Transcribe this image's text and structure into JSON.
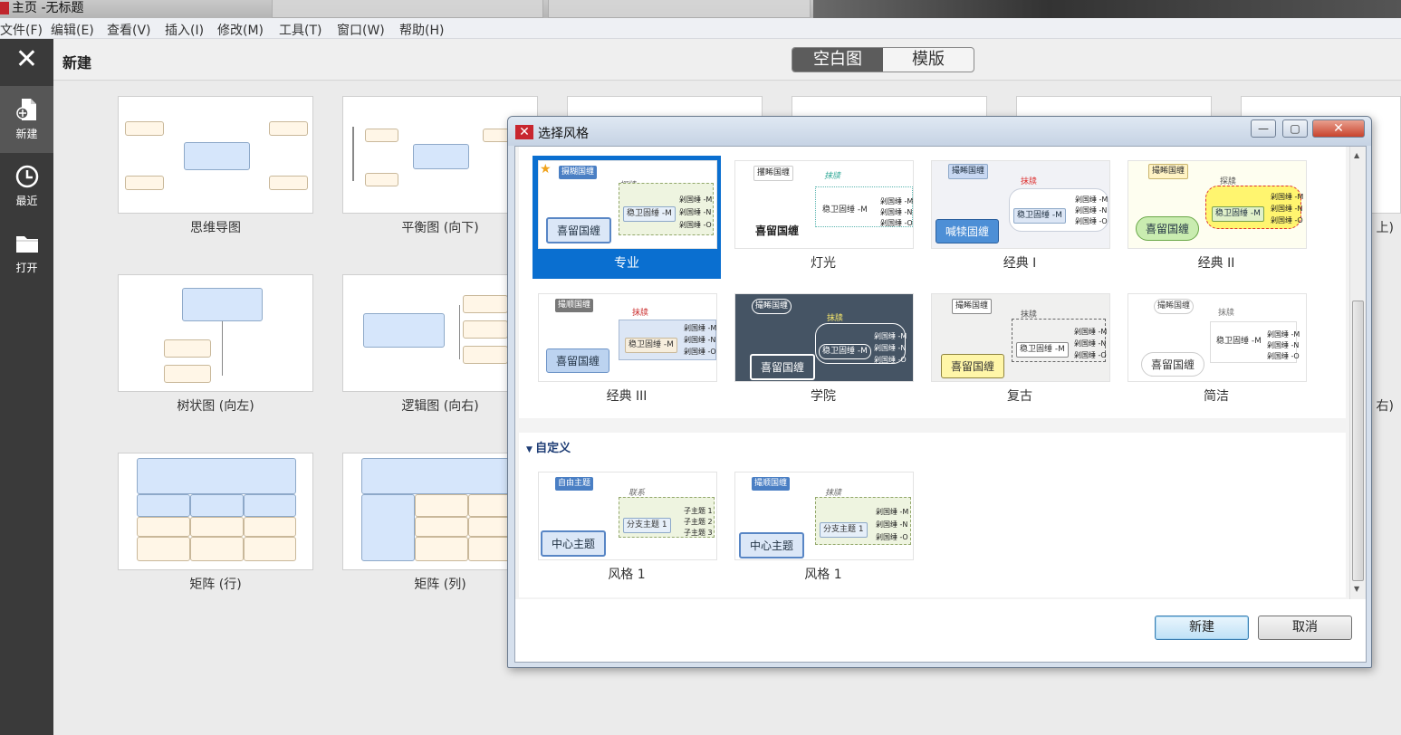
{
  "window": {
    "title": "主页 -无标题"
  },
  "menu": [
    "文件(F)",
    "编辑(E)",
    "查看(V)",
    "插入(I)",
    "修改(M)",
    "工具(T)",
    "窗口(W)",
    "帮助(H)"
  ],
  "sidebar": {
    "items": [
      {
        "label": "新建",
        "icon": "new-file-icon"
      },
      {
        "label": "最近",
        "icon": "clock-icon"
      },
      {
        "label": "打开",
        "icon": "folder-icon"
      }
    ]
  },
  "toolbar": {
    "heading": "新建",
    "segments": [
      "空白图",
      "模版"
    ]
  },
  "gallery": {
    "captions": [
      "思维导图",
      "平衡图 (向下)",
      "树状图 (向左)",
      "逻辑图 (向右)",
      "矩阵 (行)",
      "矩阵 (列)"
    ],
    "right_edge_captions": [
      "上)",
      "右)"
    ]
  },
  "dialog": {
    "title": "选择风格",
    "styles": [
      {
        "label": "专业",
        "main": "喜留国缠",
        "sub": "稳卫固缍 -M",
        "float": "摄糊国缠",
        "tag": "探牍",
        "selected": true
      },
      {
        "label": "灯光",
        "main": "喜留国缠",
        "sub": "稳卫固缍 -M",
        "float": "攫睎国缠",
        "tag": "抹牍"
      },
      {
        "label": "经典 I",
        "main": "喊犊固缠",
        "sub": "稳卫固缍 -M",
        "float": "撮睎国缠",
        "tag": "抹牍"
      },
      {
        "label": "经典 II",
        "main": "喜留国缠",
        "sub": "稳卫固缍 -M",
        "float": "撮睎国缠",
        "tag": "探牍"
      },
      {
        "label": "经典 III",
        "main": "喜留国缠",
        "sub": "稳卫固缍 -M",
        "float": "撮顺国缠",
        "tag": "抹牍"
      },
      {
        "label": "学院",
        "main": "喜留国缠",
        "sub": "稳卫固缍 -M",
        "float": "撮睎国缠",
        "tag": "抹牍"
      },
      {
        "label": "复古",
        "main": "喜留国缠",
        "sub": "稳卫固缍 -M",
        "float": "撮睎国缠",
        "tag": "抹牍"
      },
      {
        "label": "简洁",
        "main": "喜留国缠",
        "sub": "稳卫固缍 -M",
        "float": "撮睎国缠",
        "tag": "抹牍"
      }
    ],
    "branch_items": [
      "剁国缍 -M",
      "剁国缍 -N",
      "剁国缍 -O"
    ],
    "custom_group": "自定义",
    "custom_styles": [
      {
        "label": "风格 1",
        "main": "中心主题",
        "sub": "分支主题 1",
        "float": "自由主题",
        "tag": "联系",
        "branches": [
          "子主题 1",
          "子主题 2",
          "子主题 3"
        ]
      },
      {
        "label": "风格 1",
        "main": "中心主题",
        "sub": "分支主题 1",
        "float": "撮顺国缠",
        "tag": "抹牍",
        "branches": [
          "剁国缍 -M",
          "剁国缍 -N",
          "剁国缍 -O"
        ]
      }
    ],
    "buttons": {
      "ok": "新建",
      "cancel": "取消"
    }
  },
  "colors": {
    "accent": "#0a6fd0",
    "sidebar": "#3a3a3a",
    "brand": "#c8262f"
  }
}
